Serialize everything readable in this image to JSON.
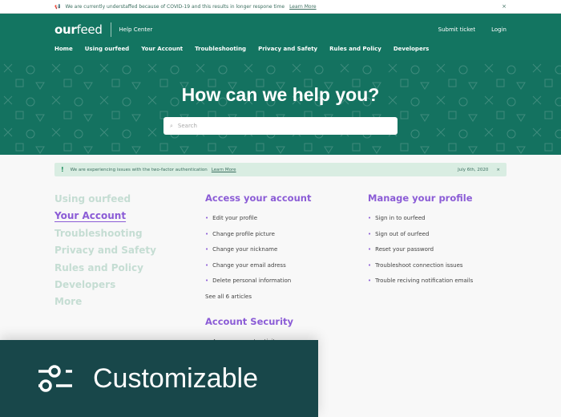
{
  "notice": {
    "text": "We are currently understaffed because of COVID-19 and this results in longer respone time",
    "link": "Learn More",
    "close": "×"
  },
  "header": {
    "logo_bold": "our",
    "logo_light": "feed",
    "section": "Help Center",
    "submit": "Submit ticket",
    "login": "Login",
    "nav": [
      "Home",
      "Using ourfeed",
      "Your Account",
      "Troubleshooting",
      "Privacy and Safety",
      "Rules and Policy",
      "Developers"
    ]
  },
  "hero": {
    "title": "How can we help you?",
    "search_placeholder": "Search"
  },
  "alert": {
    "text": "We are experiencing issues with the two-factor authentication",
    "link": "Learn More",
    "date": "July 6th, 2020",
    "close": "×"
  },
  "sidebar": [
    "Using ourfeed",
    "Your Account",
    "Troubleshooting",
    "Privacy and Safety",
    "Rules and Policy",
    "Developers",
    "More"
  ],
  "access": {
    "title": "Access your account",
    "items": [
      "Edit your profile",
      "Change profile picture",
      "Change your nickname",
      "Change your email adress",
      "Delete personal information"
    ],
    "see_all": "See all 6 articles"
  },
  "security": {
    "title": "Account Security",
    "items": [
      "Access account activity"
    ]
  },
  "manage": {
    "title": "Manage your profile",
    "items": [
      "Sign in to ourfeed",
      "Sign out of ourfeed",
      "Reset your password",
      "Troubleshoot connection issues",
      "Trouble reciving notification emails"
    ]
  },
  "overlay": {
    "label": "Customizable",
    "icon": "sliders-icon"
  },
  "colors": {
    "brand": "#137561",
    "accent": "#8b5cd6",
    "overlay": "#18474a"
  }
}
